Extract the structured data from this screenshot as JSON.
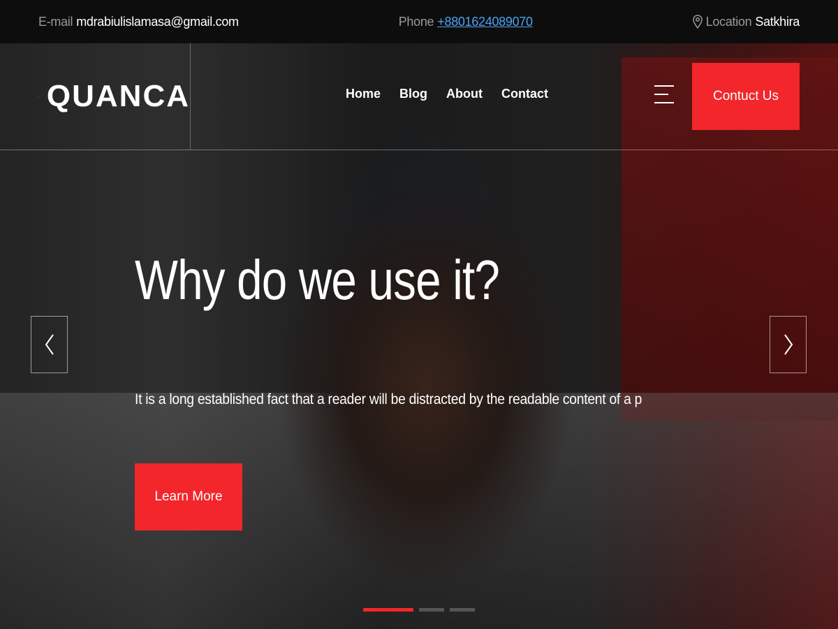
{
  "topbar": {
    "email_label": "E-mail",
    "email_value": "mdrabiulislamasa@gmail.com",
    "phone_label": "Phone",
    "phone_value": "+8801624089070",
    "location_label": "Location",
    "location_value": "Satkhira"
  },
  "brand": {
    "name": "QUANCA",
    "accent_color": "#f2262b"
  },
  "nav": {
    "items": [
      {
        "label": "Home"
      },
      {
        "label": "Blog"
      },
      {
        "label": "About"
      },
      {
        "label": "Contact"
      }
    ],
    "contact_button": "Contuct Us"
  },
  "hero": {
    "headline": "Why do we use it?",
    "subtext": "It is a long established fact that a reader will be distracted by the readable content of a page when...",
    "cta": "Learn More",
    "prev_icon": "chevron-left-icon",
    "next_icon": "chevron-right-icon"
  },
  "slider": {
    "slide_count": 3,
    "active_index": 0
  }
}
